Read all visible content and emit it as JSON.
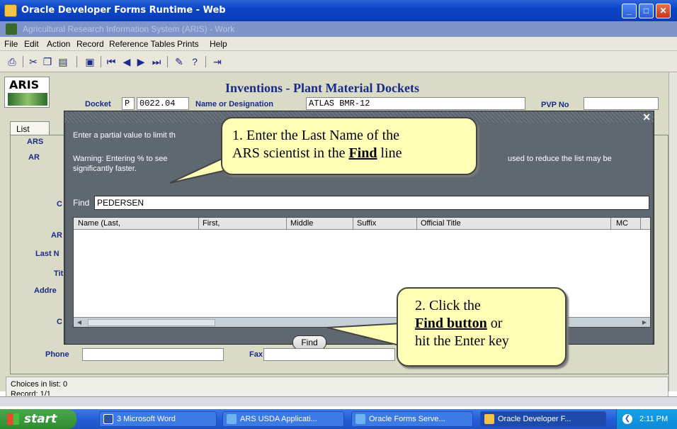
{
  "window": {
    "title": "Oracle Developer Forms Runtime - Web"
  },
  "app": {
    "title": "Agricultural Research Information System (ARIS) - Work"
  },
  "menu": [
    "File",
    "Edit",
    "Action",
    "Record",
    "Reference Tables",
    "Prints",
    "Help"
  ],
  "toolbar": [
    "print-icon",
    "cut-icon",
    "copy-icon",
    "paste-icon",
    "query-icon",
    "first-record-icon",
    "previous-record-icon",
    "next-record-icon",
    "last-record-icon",
    "edit-icon",
    "help-icon",
    "exit-icon"
  ],
  "form": {
    "logo": "ARIS",
    "title": "Inventions - Plant Material Dockets",
    "docket_label": "Docket",
    "docket_prefix": "P",
    "docket_value": "0022.04",
    "name_label": "Name or Designation",
    "name_value": "ATLAS BMR-12",
    "pvp_label": "PVP No",
    "pvp_value": ""
  },
  "tab": {
    "list": "List"
  },
  "side_labels": [
    "ARS",
    "AR",
    "C",
    "AR",
    "Last N",
    "Tit",
    "Addre",
    "C"
  ],
  "dialog": {
    "hint": "Enter a partial value to limit th",
    "warning_left": "Warning: Entering % to see",
    "warning_left2": "significantly faster.",
    "warning_right": "used to reduce the list may be",
    "find_label": "Find",
    "find_value": "PEDERSEN",
    "columns": [
      "Name (Last,",
      "First,",
      "Middle",
      "Suffix",
      "Official Title",
      "MC"
    ],
    "find_button": "Find"
  },
  "callouts": {
    "one_line1": "1. Enter the Last Name of the",
    "one_line2a": "ARS scientist in the ",
    "one_find": "Find",
    "one_line2b": " line",
    "two_line1": "2. Click the",
    "two_find": "Find button",
    "two_or": " or",
    "two_line3": "hit the Enter key"
  },
  "lower": {
    "phone_label": "Phone",
    "fax_label": "Fax",
    "choices": "Choices in list: 0",
    "record": "Record: 1/1"
  },
  "taskbar": {
    "start": "start",
    "tasks": [
      "3 Microsoft Word",
      "ARS USDA Applicati...",
      "Oracle Forms Serve...",
      "Oracle Developer F..."
    ],
    "clock": "2:11 PM"
  }
}
